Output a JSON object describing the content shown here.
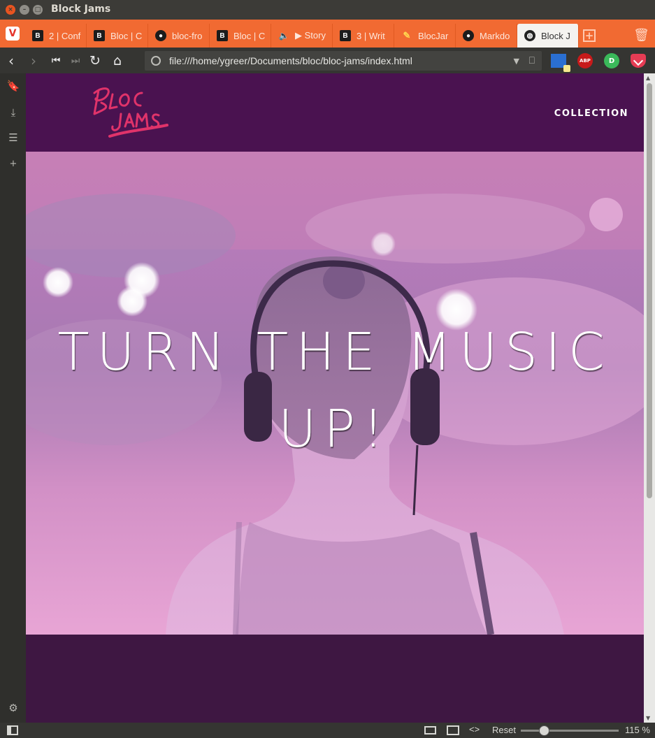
{
  "window": {
    "title": "Block Jams"
  },
  "tabs": [
    {
      "label": "2 | Conf",
      "favicon": "bloc-b-icon"
    },
    {
      "label": "Bloc | C",
      "favicon": "bloc-b-icon"
    },
    {
      "label": "bloc-fro",
      "favicon": "github-icon"
    },
    {
      "label": "Bloc | C",
      "favicon": "bloc-b-icon"
    },
    {
      "label": "▶ Story",
      "favicon": "sound-icon"
    },
    {
      "label": "3 | Writ",
      "favicon": "bloc-b-icon"
    },
    {
      "label": "BlocJar",
      "favicon": "pencil-icon"
    },
    {
      "label": "Markdo",
      "favicon": "github-icon"
    },
    {
      "label": "Block J",
      "favicon": "globe-icon",
      "active": true
    }
  ],
  "address": {
    "url": "file:///home/ygreer/Documents/bloc/bloc-jams/index.html"
  },
  "extensions": {
    "abp_label": "ABP",
    "pushbullet_label": "D"
  },
  "site": {
    "nav_link": "COLLECTION",
    "logo_text": "Bloc Jams",
    "hero_line1": "TURN THE MUSIC",
    "hero_line2": "UP!"
  },
  "statusbar": {
    "reset_label": "Reset",
    "zoom": "115 %",
    "code_glyph": "<>"
  },
  "colors": {
    "tab_strip": "#f16a32",
    "site_nav": "#4a1250",
    "hero_tint": "#c47fb7",
    "logo": "#e0336a"
  }
}
